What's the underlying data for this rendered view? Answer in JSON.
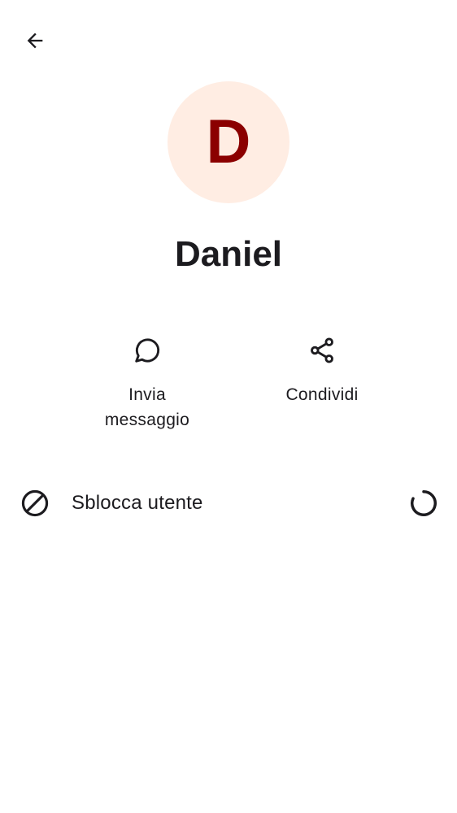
{
  "header": {
    "back_icon": "arrow-back-icon"
  },
  "profile": {
    "avatar_letter": "D",
    "avatar_bg": "#ffede3",
    "avatar_letter_color": "#8b0000",
    "name": "Daniel"
  },
  "actions": {
    "message": {
      "icon": "chat-bubble-icon",
      "label_line1": "Invia",
      "label_line2": "messaggio"
    },
    "share": {
      "icon": "share-icon",
      "label": "Condividi"
    }
  },
  "unblock": {
    "icon": "block-icon",
    "label": "Sblocca utente",
    "status_icon": "loading-spinner-icon"
  }
}
